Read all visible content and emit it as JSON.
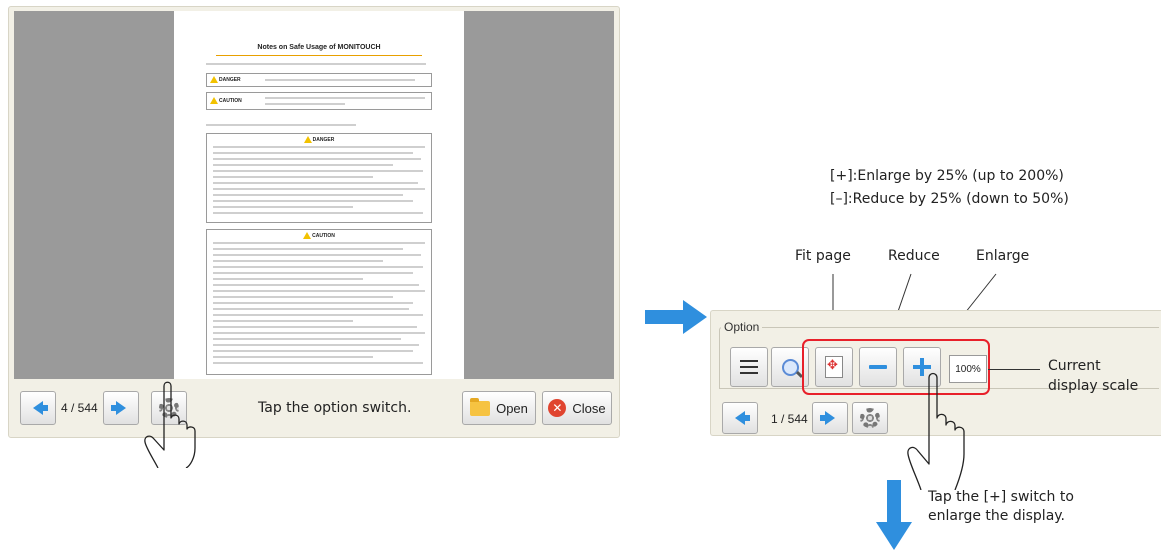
{
  "viewer": {
    "document": {
      "title": "Notes on Safe Usage of MONITOUCH",
      "danger_label": "DANGER",
      "caution_label": "CAUTION",
      "danger_heading": "DANGER",
      "caution_heading": "CAUTION"
    },
    "page_counter": "4 / 544",
    "open_label": "Open",
    "close_label": "Close"
  },
  "notes": {
    "tap_option": "Tap the option switch.",
    "zoom_rules_1": "[+]:Enlarge by 25% (up to 200%)",
    "zoom_rules_2": "[–]:Reduce by 25% (down to 50%)",
    "fit_page": "Fit page",
    "reduce": "Reduce",
    "enlarge": "Enlarge",
    "current_scale_1": "Current",
    "current_scale_2": "display scale",
    "tap_plus_1": "Tap the [+] switch to",
    "tap_plus_2": "enlarge the display."
  },
  "option_panel": {
    "legend": "Option",
    "scale_value": "100%",
    "page_counter": "1 / 544"
  },
  "colors": {
    "accent_blue": "#2f8fde",
    "highlight_red": "#e8202a",
    "panel_bg": "#f2f0e6"
  },
  "icons": [
    "arrow-left-icon",
    "arrow-right-icon",
    "gear-icon",
    "folder-icon",
    "close-icon",
    "menu-icon",
    "magnifier-icon",
    "fit-page-icon",
    "minus-icon",
    "plus-icon",
    "hand-pointer-icon"
  ]
}
